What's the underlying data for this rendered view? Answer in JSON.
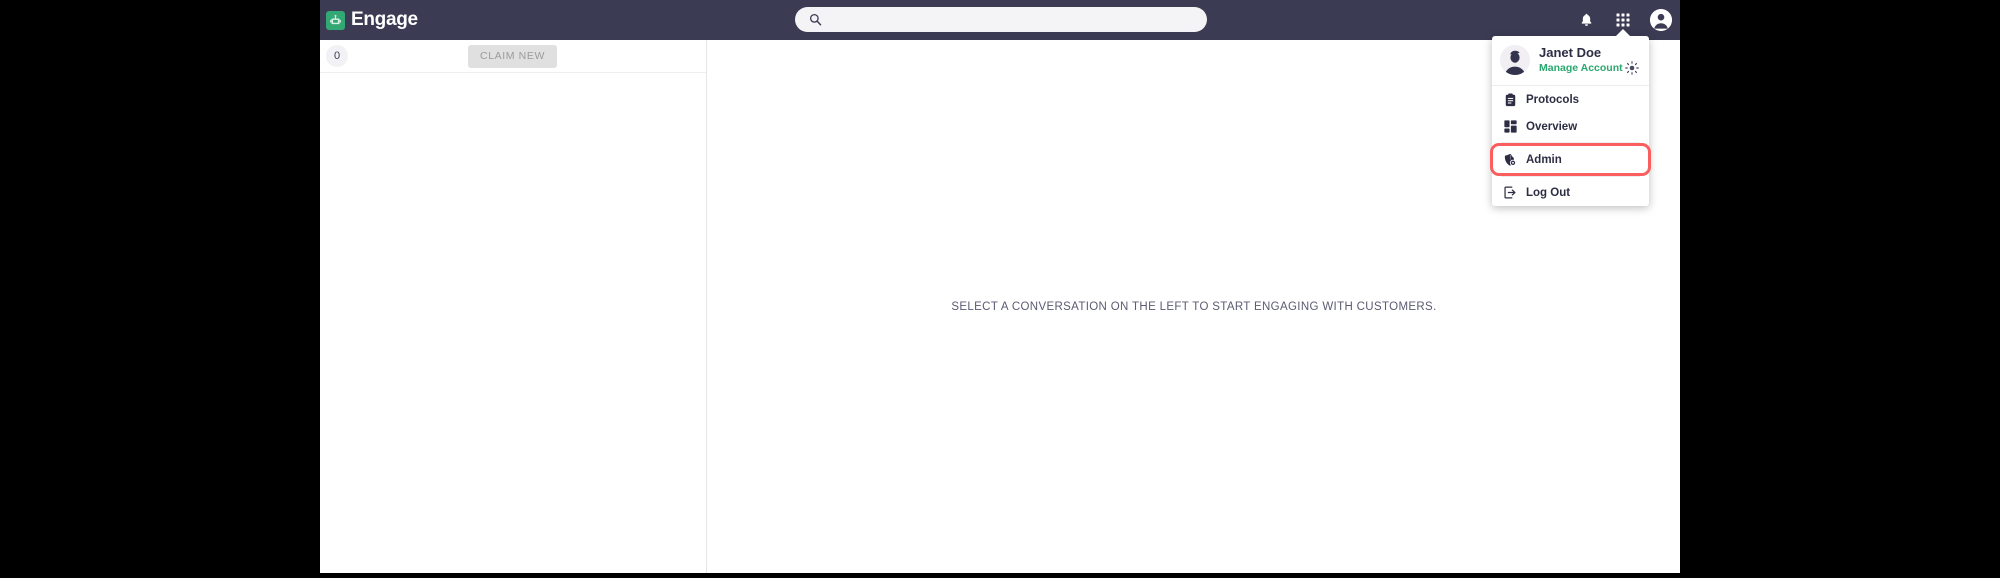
{
  "app": {
    "brand_name": "Engage",
    "brand_icon": "engage-logo-icon",
    "accent_green": "#34a874",
    "topbar_bg": "#3b3b54",
    "highlight_red": "#fb5e5e"
  },
  "topbar": {
    "search": {
      "value": "",
      "placeholder": "",
      "icon": "search-icon"
    },
    "actions": [
      {
        "name": "notifications-bell-icon",
        "label": "Notifications"
      },
      {
        "name": "app-grid-icon",
        "label": "Apps"
      },
      {
        "name": "avatar-icon",
        "label": "Account"
      }
    ]
  },
  "left_panel": {
    "unread_count": "0",
    "claim_new_label": "CLAIM NEW",
    "conversations": []
  },
  "main": {
    "empty_state_text": "SELECT A CONVERSATION ON THE LEFT TO START ENGAGING WITH CUSTOMERS."
  },
  "account_menu": {
    "user_name": "Janet Doe",
    "manage_account_label": "Manage Account",
    "theme_toggle_icon": "sun-icon",
    "items": [
      {
        "label": "Protocols",
        "icon": "clipboard-icon",
        "highlighted": false
      },
      {
        "label": "Overview",
        "icon": "dashboard-grid-icon",
        "highlighted": false
      },
      {
        "label": "Admin",
        "icon": "admin-shield-icon",
        "highlighted": true
      },
      {
        "label": "Log Out",
        "icon": "logout-arrow-icon",
        "highlighted": false
      }
    ]
  }
}
